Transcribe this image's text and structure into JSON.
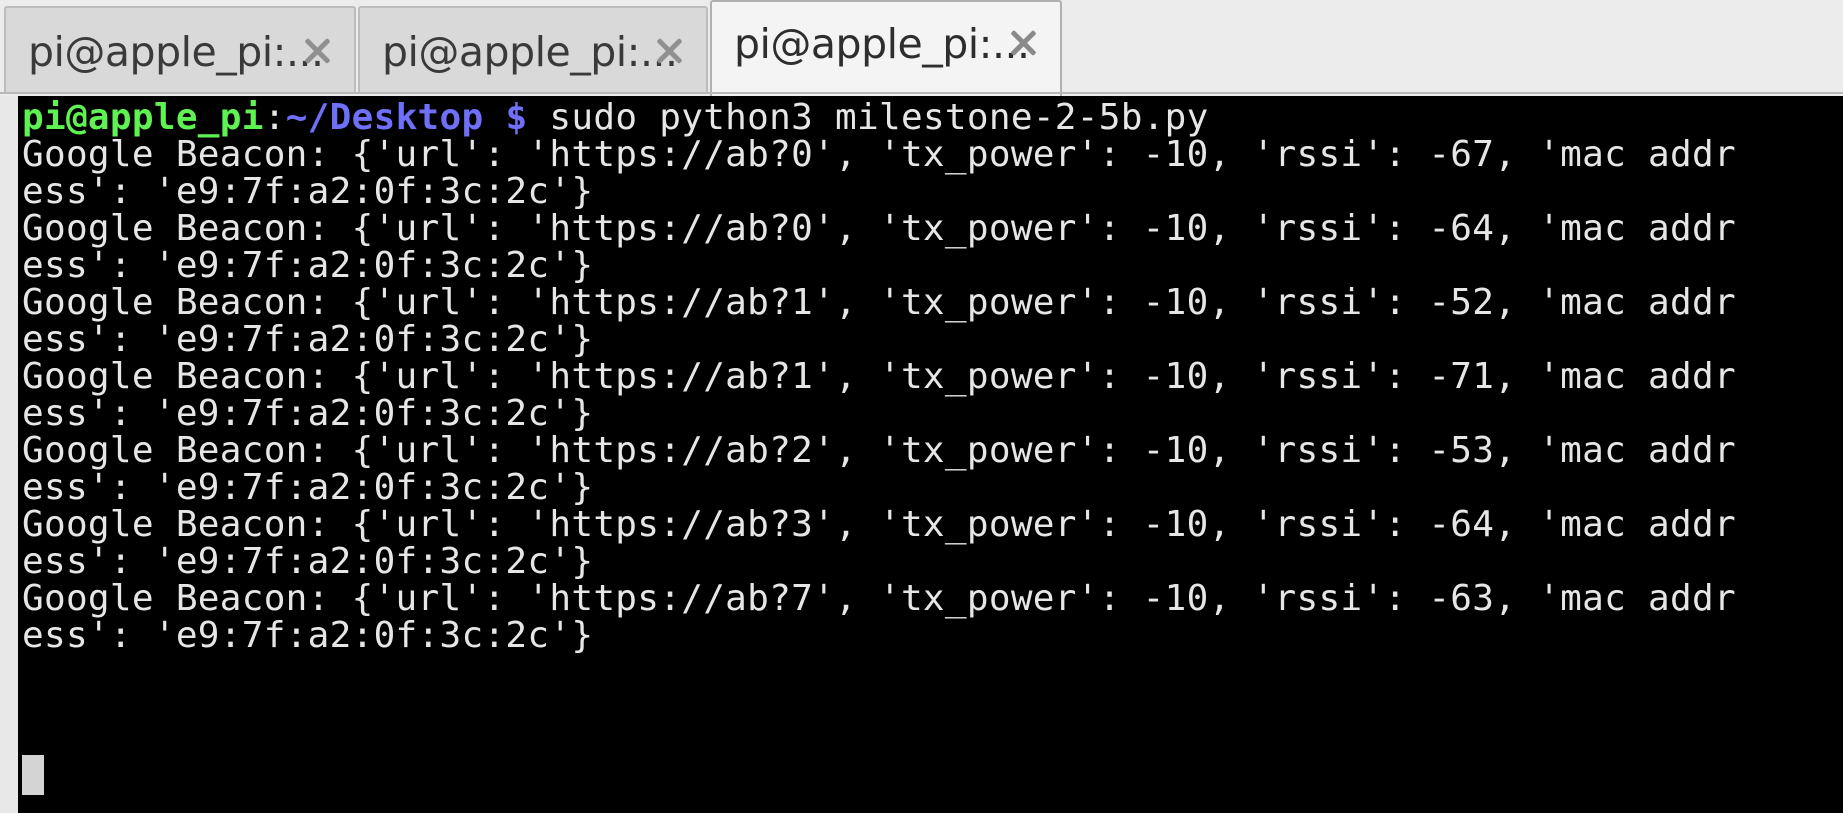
{
  "tabs": [
    {
      "label": "pi@apple_pi:..."
    },
    {
      "label": "pi@apple_pi:..."
    },
    {
      "label": "pi@apple_pi:..."
    }
  ],
  "prompt": {
    "user_host": "pi@apple_pi",
    "colon": ":",
    "path": "~/Desktop",
    "symbol": " $",
    "command": " sudo python3 milestone-2-5b.py"
  },
  "output_lines": [
    "Google Beacon: {'url': 'https://ab?0', 'tx_power': -10, 'rssi': -67, 'mac addr",
    "ess': 'e9:7f:a2:0f:3c:2c'}",
    "Google Beacon: {'url': 'https://ab?0', 'tx_power': -10, 'rssi': -64, 'mac addr",
    "ess': 'e9:7f:a2:0f:3c:2c'}",
    "Google Beacon: {'url': 'https://ab?1', 'tx_power': -10, 'rssi': -52, 'mac addr",
    "ess': 'e9:7f:a2:0f:3c:2c'}",
    "Google Beacon: {'url': 'https://ab?1', 'tx_power': -10, 'rssi': -71, 'mac addr",
    "ess': 'e9:7f:a2:0f:3c:2c'}",
    "Google Beacon: {'url': 'https://ab?2', 'tx_power': -10, 'rssi': -53, 'mac addr",
    "ess': 'e9:7f:a2:0f:3c:2c'}",
    "Google Beacon: {'url': 'https://ab?3', 'tx_power': -10, 'rssi': -64, 'mac addr",
    "ess': 'e9:7f:a2:0f:3c:2c'}",
    "Google Beacon: {'url': 'https://ab?7', 'tx_power': -10, 'rssi': -63, 'mac addr",
    "ess': 'e9:7f:a2:0f:3c:2c'}"
  ],
  "icons": {
    "tab_close": "close-icon",
    "cursor": "block-cursor"
  },
  "colors": {
    "terminal_background": "#000000",
    "terminal_text": "#e6e6e6",
    "prompt_user_host": "#5ff252",
    "prompt_path": "#6f6ff8",
    "active_tab_background": "#f4f4f4",
    "inactive_tab_background": "#d9d9d9"
  }
}
